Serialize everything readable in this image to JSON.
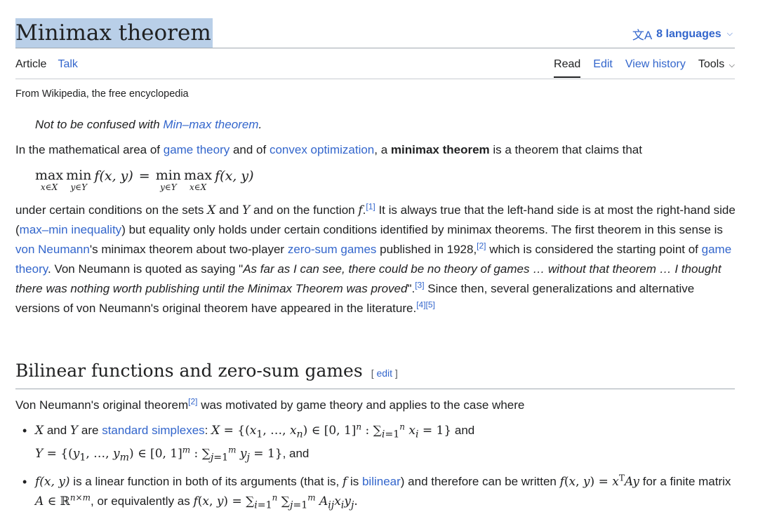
{
  "article": {
    "title": "Minimax theorem",
    "languages_label": "8 languages",
    "tabs_left": [
      "Article",
      "Talk"
    ],
    "tabs_right": [
      "Read",
      "Edit",
      "View history",
      "Tools"
    ],
    "tagline": "From Wikipedia, the free encyclopedia"
  },
  "hatnote": {
    "prefix": "Not to be confused with ",
    "link": "Min–max theorem",
    "suffix": "."
  },
  "intro": {
    "p1_a": "In the mathematical area of ",
    "link_game_theory": "game theory",
    "p1_b": " and of ",
    "link_convex": "convex optimization",
    "p1_c": ", a ",
    "bold": "minimax theorem",
    "p1_d": " is a theorem that claims that",
    "p2_a": "under certain conditions on the sets ",
    "p2_b": " and ",
    "p2_c": " and on the function ",
    "ref1": "[1]",
    "p2_d": " It is always true that the left-hand side is at most the right-hand side (",
    "link_maxmin": "max–min inequality",
    "p2_e": ") but equality only holds under certain conditions identified by minimax theorems. The first theorem in this sense is ",
    "link_vonneumann": "von Neumann",
    "p2_f": "'s minimax theorem about two-player ",
    "link_zerosum": "zero-sum games",
    "p2_g": " published in 1928,",
    "ref2": "[2]",
    "p2_h": " which is considered the starting point of ",
    "link_game_theory2": "game theory",
    "p2_i": ". Von Neumann is quoted as saying \"",
    "quote": "As far as I can see, there could be no theory of games … without that theorem … I thought there was nothing worth publishing until the Minimax Theorem was proved",
    "p2_j": "\".",
    "ref3": "[3]",
    "p2_k": " Since then, several generalizations and alternative versions of von Neumann's original theorem have appeared in the literature.",
    "ref45": "[4][5]"
  },
  "section": {
    "heading": "Bilinear functions and zero-sum games",
    "edit_label": "edit",
    "lead_a": "Von Neumann's original theorem",
    "ref2": "[2]",
    "lead_b": " was motivated by game theory and applies to the case where",
    "b1_and": " and ",
    "b1_are": " are ",
    "b1_link": "standard simplexes",
    "b1_colon": ": ",
    "b1_and2": " and",
    "b1_end": ", and",
    "b2_a": " is a linear function in both of its arguments (that is, ",
    "b2_b": " is ",
    "b2_link": "bilinear",
    "b2_c": ") and therefore can be written ",
    "b2_d": " for a finite matrix ",
    "b2_e": ", or equivalently as "
  }
}
